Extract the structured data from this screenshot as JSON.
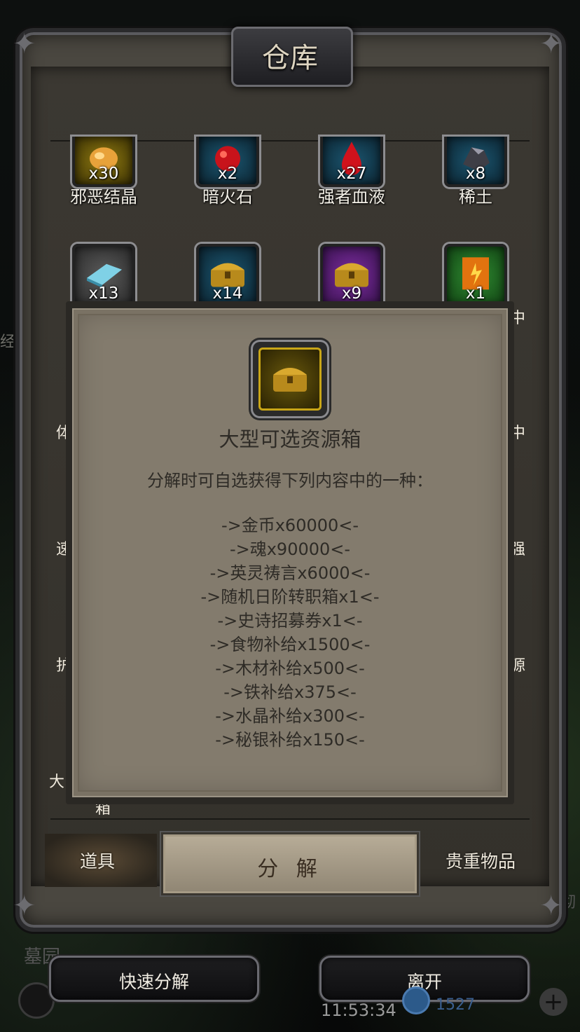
{
  "window": {
    "title": "仓库"
  },
  "items": [
    {
      "name": "邪恶结晶",
      "count": "x30",
      "icon": "evil-crystal-icon"
    },
    {
      "name": "暗火石",
      "count": "x2",
      "icon": "dark-fire-stone-icon"
    },
    {
      "name": "强者血液",
      "count": "x27",
      "icon": "blood-drop-icon"
    },
    {
      "name": "稀土",
      "count": "x8",
      "icon": "rare-earth-ore-icon"
    },
    {
      "name": "",
      "count": "x13",
      "icon": "ice-ingot-icon"
    },
    {
      "name": "",
      "count": "x14",
      "icon": "gold-chest-icon"
    },
    {
      "name": "",
      "count": "x9",
      "icon": "gold-chest-icon"
    },
    {
      "name": "",
      "count": "x1",
      "icon": "fire-scroll-icon"
    }
  ],
  "side_fragments": {
    "left": [
      "经",
      "体",
      "速",
      "护",
      "大",
      "箱"
    ],
    "right": [
      "中",
      "中",
      "强",
      "源"
    ]
  },
  "tooltip": {
    "icon": "gold-chest-icon",
    "title": "大型可选资源箱",
    "description": "分解时可自选获得下列内容中的一种：",
    "options": [
      "->金币x60000<-",
      "->魂x90000<-",
      "->英灵祷言x6000<-",
      "->随机日阶转职箱x1<-",
      "->史诗招募券x1<-",
      "->食物补给x1500<-",
      "->木材补给x500<-",
      "->铁补给x375<-",
      "->水晶补给x300<-",
      "->秘银补给x150<-"
    ]
  },
  "tabs": {
    "items": "道具",
    "decompose": "分 解",
    "valuables": "贵重物品"
  },
  "bottom_buttons": {
    "quick_decompose": "快速分解",
    "leave": "离开"
  },
  "status": {
    "clock": "11:53:34",
    "currency": "1527",
    "background_label": "墓园",
    "right_fragment": "彻"
  }
}
